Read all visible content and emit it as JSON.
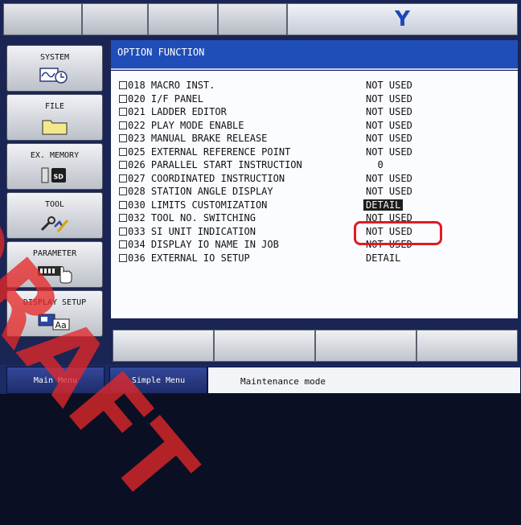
{
  "topbar": {
    "axis_label": "Y"
  },
  "menu": [
    {
      "label": "SYSTEM",
      "icon": "system-waveform-clock-icon"
    },
    {
      "label": "FILE",
      "icon": "folder-icon"
    },
    {
      "label": "EX. MEMORY",
      "icon": "sd-card-icon"
    },
    {
      "label": "TOOL",
      "icon": "tool-wrench-icon"
    },
    {
      "label": "PARAMETER",
      "icon": "parameter-hand-icon"
    },
    {
      "label": "DISPLAY SETUP",
      "icon": "display-text-icon"
    }
  ],
  "panel": {
    "title": "OPTION FUNCTION",
    "rows": [
      {
        "name": "018 MACRO INST.",
        "value": "NOT USED"
      },
      {
        "name": "020 I/F PANEL",
        "value": "NOT USED"
      },
      {
        "name": "021 LADDER EDITOR",
        "value": "NOT USED"
      },
      {
        "name": "022 PLAY MODE ENABLE",
        "value": "NOT USED"
      },
      {
        "name": "023 MANUAL BRAKE RELEASE",
        "value": "NOT USED"
      },
      {
        "name": "025 EXTERNAL REFERENCE POINT",
        "value": "NOT USED"
      },
      {
        "name": "026 PARALLEL START INSTRUCTION",
        "value": "  0"
      },
      {
        "name": "027 COORDINATED INSTRUCTION",
        "value": "NOT USED"
      },
      {
        "name": "028 STATION ANGLE DISPLAY",
        "value": "NOT USED"
      },
      {
        "name": "030 LIMITS CUSTOMIZATION",
        "value": "DETAIL",
        "selected": true
      },
      {
        "name": "032 TOOL NO. SWITCHING",
        "value": "NOT USED"
      },
      {
        "name": "033 SI UNIT INDICATION",
        "value": "NOT USED"
      },
      {
        "name": "034 DISPLAY IO NAME IN JOB",
        "value": "NOT USED"
      },
      {
        "name": "036 EXTERNAL IO SETUP",
        "value": "DETAIL"
      }
    ]
  },
  "statusbar": {
    "main_menu": "Main Menu",
    "simple_menu": "Simple Menu",
    "mode": "Maintenance mode"
  },
  "watermark": "DRAFT",
  "colors": {
    "title_bar": "#1f4eb8",
    "highlight": "#e01b24",
    "selected_bg": "#1c1c1c"
  }
}
